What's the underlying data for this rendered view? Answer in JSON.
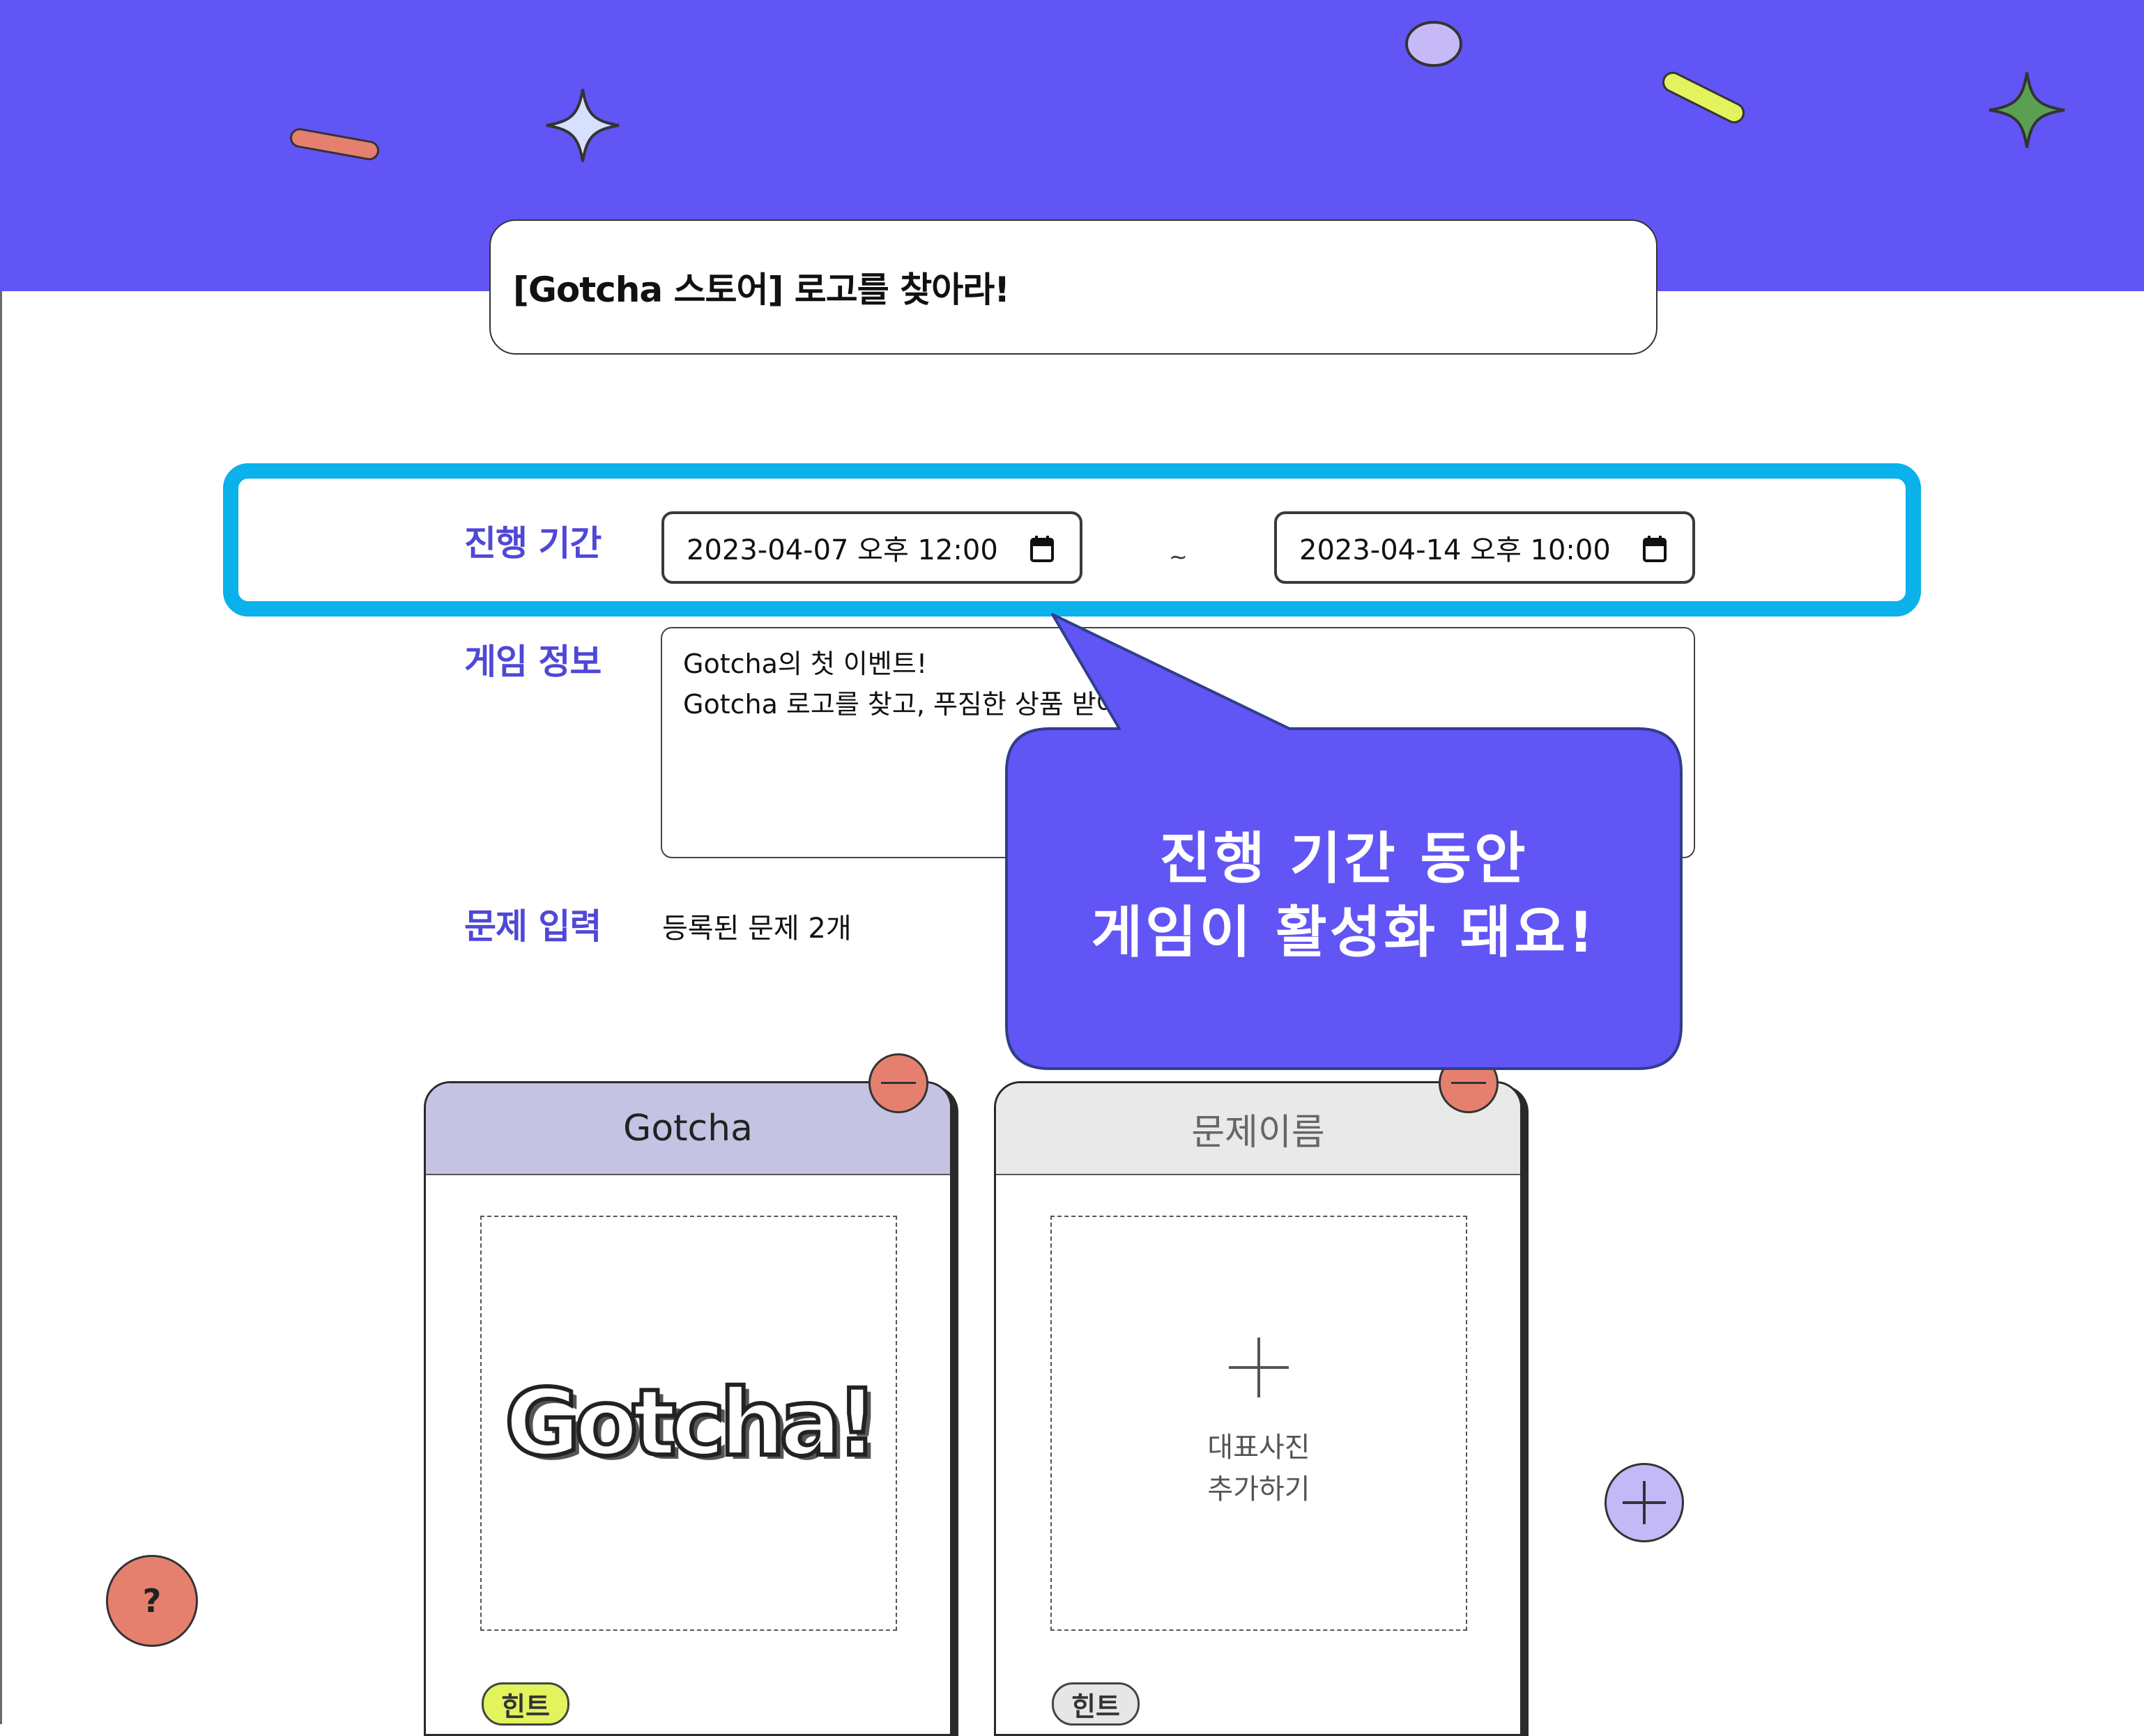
{
  "colors": {
    "banner": "#6155F5",
    "accent": "#4F48D6",
    "highlight": "#0AB1EB",
    "remove_button": "#E5806F",
    "add_button": "#C3B9F7",
    "card_active_header": "#C4C3E3",
    "card_empty_header": "#E9E9E9",
    "hint_active": "#E2F35E",
    "hint_inactive": "#E6E6E6"
  },
  "game": {
    "title": "[Gotcha 스토어] 로고를 찾아라!"
  },
  "period": {
    "label": "진행 기간",
    "start": "2023-04-07 오후 12:00",
    "end": "2023-04-14 오후 10:00",
    "separator": "~",
    "calendar_icon": "calendar-icon"
  },
  "info": {
    "label": "게임 정보",
    "lines": [
      "Gotcha의 첫 이벤트!",
      "Gotcha 로고를 찾고, 푸짐한 상품 받아"
    ]
  },
  "problems": {
    "label": "문제 입력",
    "count_text": "등록된 문제 2개",
    "cards": [
      {
        "name": "Gotcha",
        "image_text": "Gotcha!",
        "hint": "힌트"
      },
      {
        "name": "문제이름",
        "add_photo_lines": [
          "대표사진",
          "추가하기"
        ],
        "hint": "힌트"
      }
    ]
  },
  "tooltip": {
    "lines": [
      "진행 기간 동안",
      "게임이 활성화 돼요!"
    ]
  },
  "help_button": {
    "label": "?"
  }
}
